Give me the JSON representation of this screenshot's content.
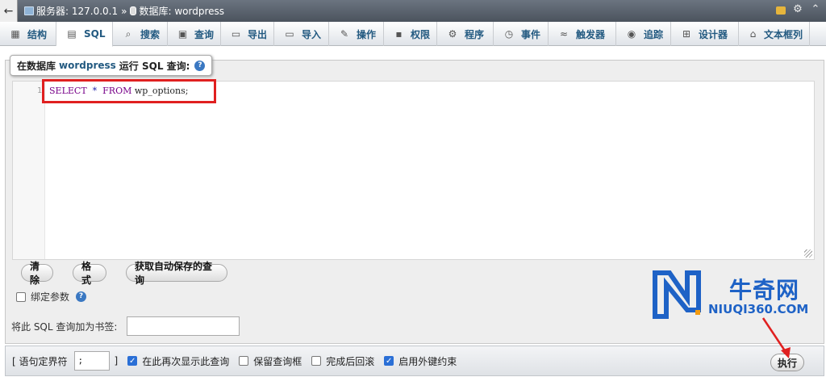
{
  "breadcrumb": {
    "back": "←",
    "server": "服务器: 127.0.0.1",
    "separator": "»",
    "database": "数据库: wordpress"
  },
  "tabs": [
    {
      "label": "结构",
      "icon": "structure-icon"
    },
    {
      "label": "SQL",
      "icon": "sql-icon",
      "active": true
    },
    {
      "label": "搜索",
      "icon": "search-icon"
    },
    {
      "label": "查询",
      "icon": "query-icon"
    },
    {
      "label": "导出",
      "icon": "export-icon"
    },
    {
      "label": "导入",
      "icon": "import-icon"
    },
    {
      "label": "操作",
      "icon": "wrench-icon"
    },
    {
      "label": "权限",
      "icon": "privileges-icon"
    },
    {
      "label": "程序",
      "icon": "routines-icon"
    },
    {
      "label": "事件",
      "icon": "clock-icon"
    },
    {
      "label": "触发器",
      "icon": "trigger-icon"
    },
    {
      "label": "追踪",
      "icon": "eye-icon"
    },
    {
      "label": "设计器",
      "icon": "designer-icon"
    },
    {
      "label": "文本框列",
      "icon": "home-icon"
    }
  ],
  "legend": {
    "prefix": "在数据库",
    "dbname": "wordpress",
    "suffix": "运行 SQL 查询:"
  },
  "editor": {
    "line_number": "1",
    "kw_select": "SELECT",
    "star": "*",
    "kw_from": "FROM",
    "table": "wp_options;"
  },
  "buttons": {
    "clear": "清除",
    "format": "格式",
    "get_autosaved": "获取自动保存的查询"
  },
  "bind_params": "绑定参数",
  "bookmark_label": "将此 SQL 查询加为书签:",
  "bottom": {
    "delimiter_label_open": "[ 语句定界符",
    "delimiter_value": ";",
    "delimiter_label_close": "]",
    "opt_show_again": "在此再次显示此查询",
    "opt_keep_box": "保留查询框",
    "opt_rollback": "完成后回滚",
    "opt_fk": "启用外键约束",
    "go": "执行"
  },
  "options_checked": {
    "show_again": true,
    "keep_box": false,
    "rollback": false,
    "fk": true
  },
  "watermark": {
    "cn": "牛奇网",
    "en": "NIUQI360.COM"
  },
  "colors": {
    "accent": "#235a81",
    "highlight": "#e02020",
    "watermark": "#1e62c6"
  }
}
